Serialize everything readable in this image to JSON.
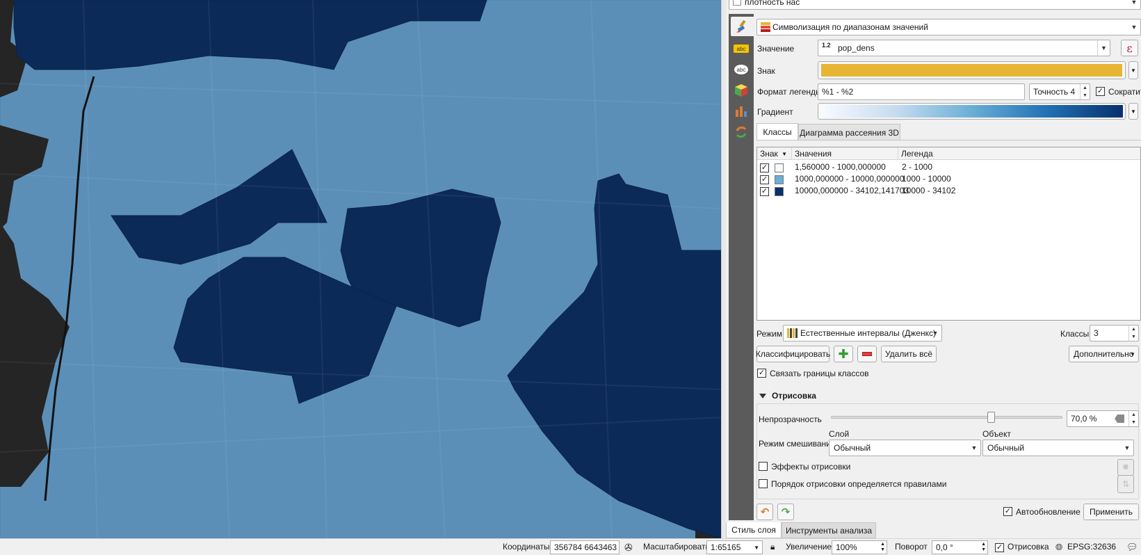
{
  "layer_selector": {
    "value": "плотность нас"
  },
  "renderer": {
    "value": "Символизация по диапазонам значений",
    "icon": "graduated-renderer-icon"
  },
  "value_row": {
    "label": "Значение",
    "type_prefix": "1.2",
    "value": "pop_dens",
    "expr_icon": "epsilon-icon"
  },
  "symbol_row": {
    "label": "Знак",
    "color": "#e8b433"
  },
  "legend_format_row": {
    "label": "Формат легенды",
    "value": "%1 - %2",
    "precision": "Точность 4",
    "trim_label": "Сократить нули",
    "trim_checked": true
  },
  "gradient_row": {
    "label": "Градиент",
    "start_color": "#f7fbff",
    "end_color": "#08306b"
  },
  "tabs": [
    {
      "label": "Классы"
    },
    {
      "label": "Диаграмма рассеяния 3D"
    }
  ],
  "class_table": {
    "headers": {
      "symbol": "Знак",
      "values": "Значения",
      "legend": "Легенда"
    },
    "rows": [
      {
        "checked": true,
        "color": "#f7fbff",
        "values": "1,560000 - 1000,000000",
        "legend": "2 - 1000"
      },
      {
        "checked": true,
        "color": "#6baed6",
        "values": "1000,000000 - 10000,000000",
        "legend": "1000 - 10000"
      },
      {
        "checked": true,
        "color": "#08306b",
        "values": "10000,000000 - 34102,141703",
        "legend": "10000 - 34102"
      }
    ]
  },
  "mode_row": {
    "label": "Режим",
    "value": "Естественные интервалы (Дженкс)",
    "classes_label": "Классы",
    "classes_value": "3"
  },
  "buttons": {
    "classify": "Классифицировать",
    "delete_all": "Удалить всё",
    "advanced": "Дополнительно"
  },
  "link_bounds": {
    "label": "Связать границы классов",
    "checked": true
  },
  "rendering": {
    "section_title": "Отрисовка",
    "opacity_label": "Непрозрачность",
    "opacity_value": "70,0 %",
    "opacity_fraction": 0.7,
    "blend_label": "Режим смешивания",
    "layer_label": "Слой",
    "layer_value": "Обычный",
    "feature_label": "Объект",
    "feature_value": "Обычный",
    "effects_label": "Эффекты отрисовки",
    "order_label": "Порядок отрисовки определяется правилами"
  },
  "footer": {
    "live_update": "Автообновление",
    "live_checked": true,
    "apply": "Применить"
  },
  "dock_tabs": [
    {
      "label": "Стиль слоя"
    },
    {
      "label": "Инструменты анализа"
    }
  ],
  "status": {
    "coords_label": "Координаты",
    "coords_value": "356784 6643463",
    "scale_label": "Масштабировать",
    "scale_value": "1:65165",
    "magnifier_label": "Увеличение",
    "magnifier_value": "100%",
    "rotation_label": "Поворот",
    "rotation_value": "0,0 °",
    "render_label": "Отрисовка",
    "render_checked": true,
    "crs": "EPSG:32636"
  },
  "map_colors": {
    "background": "#252525",
    "light": "#5b8fb8",
    "dark": "#0c2a58",
    "water": "#6e9cc2"
  }
}
